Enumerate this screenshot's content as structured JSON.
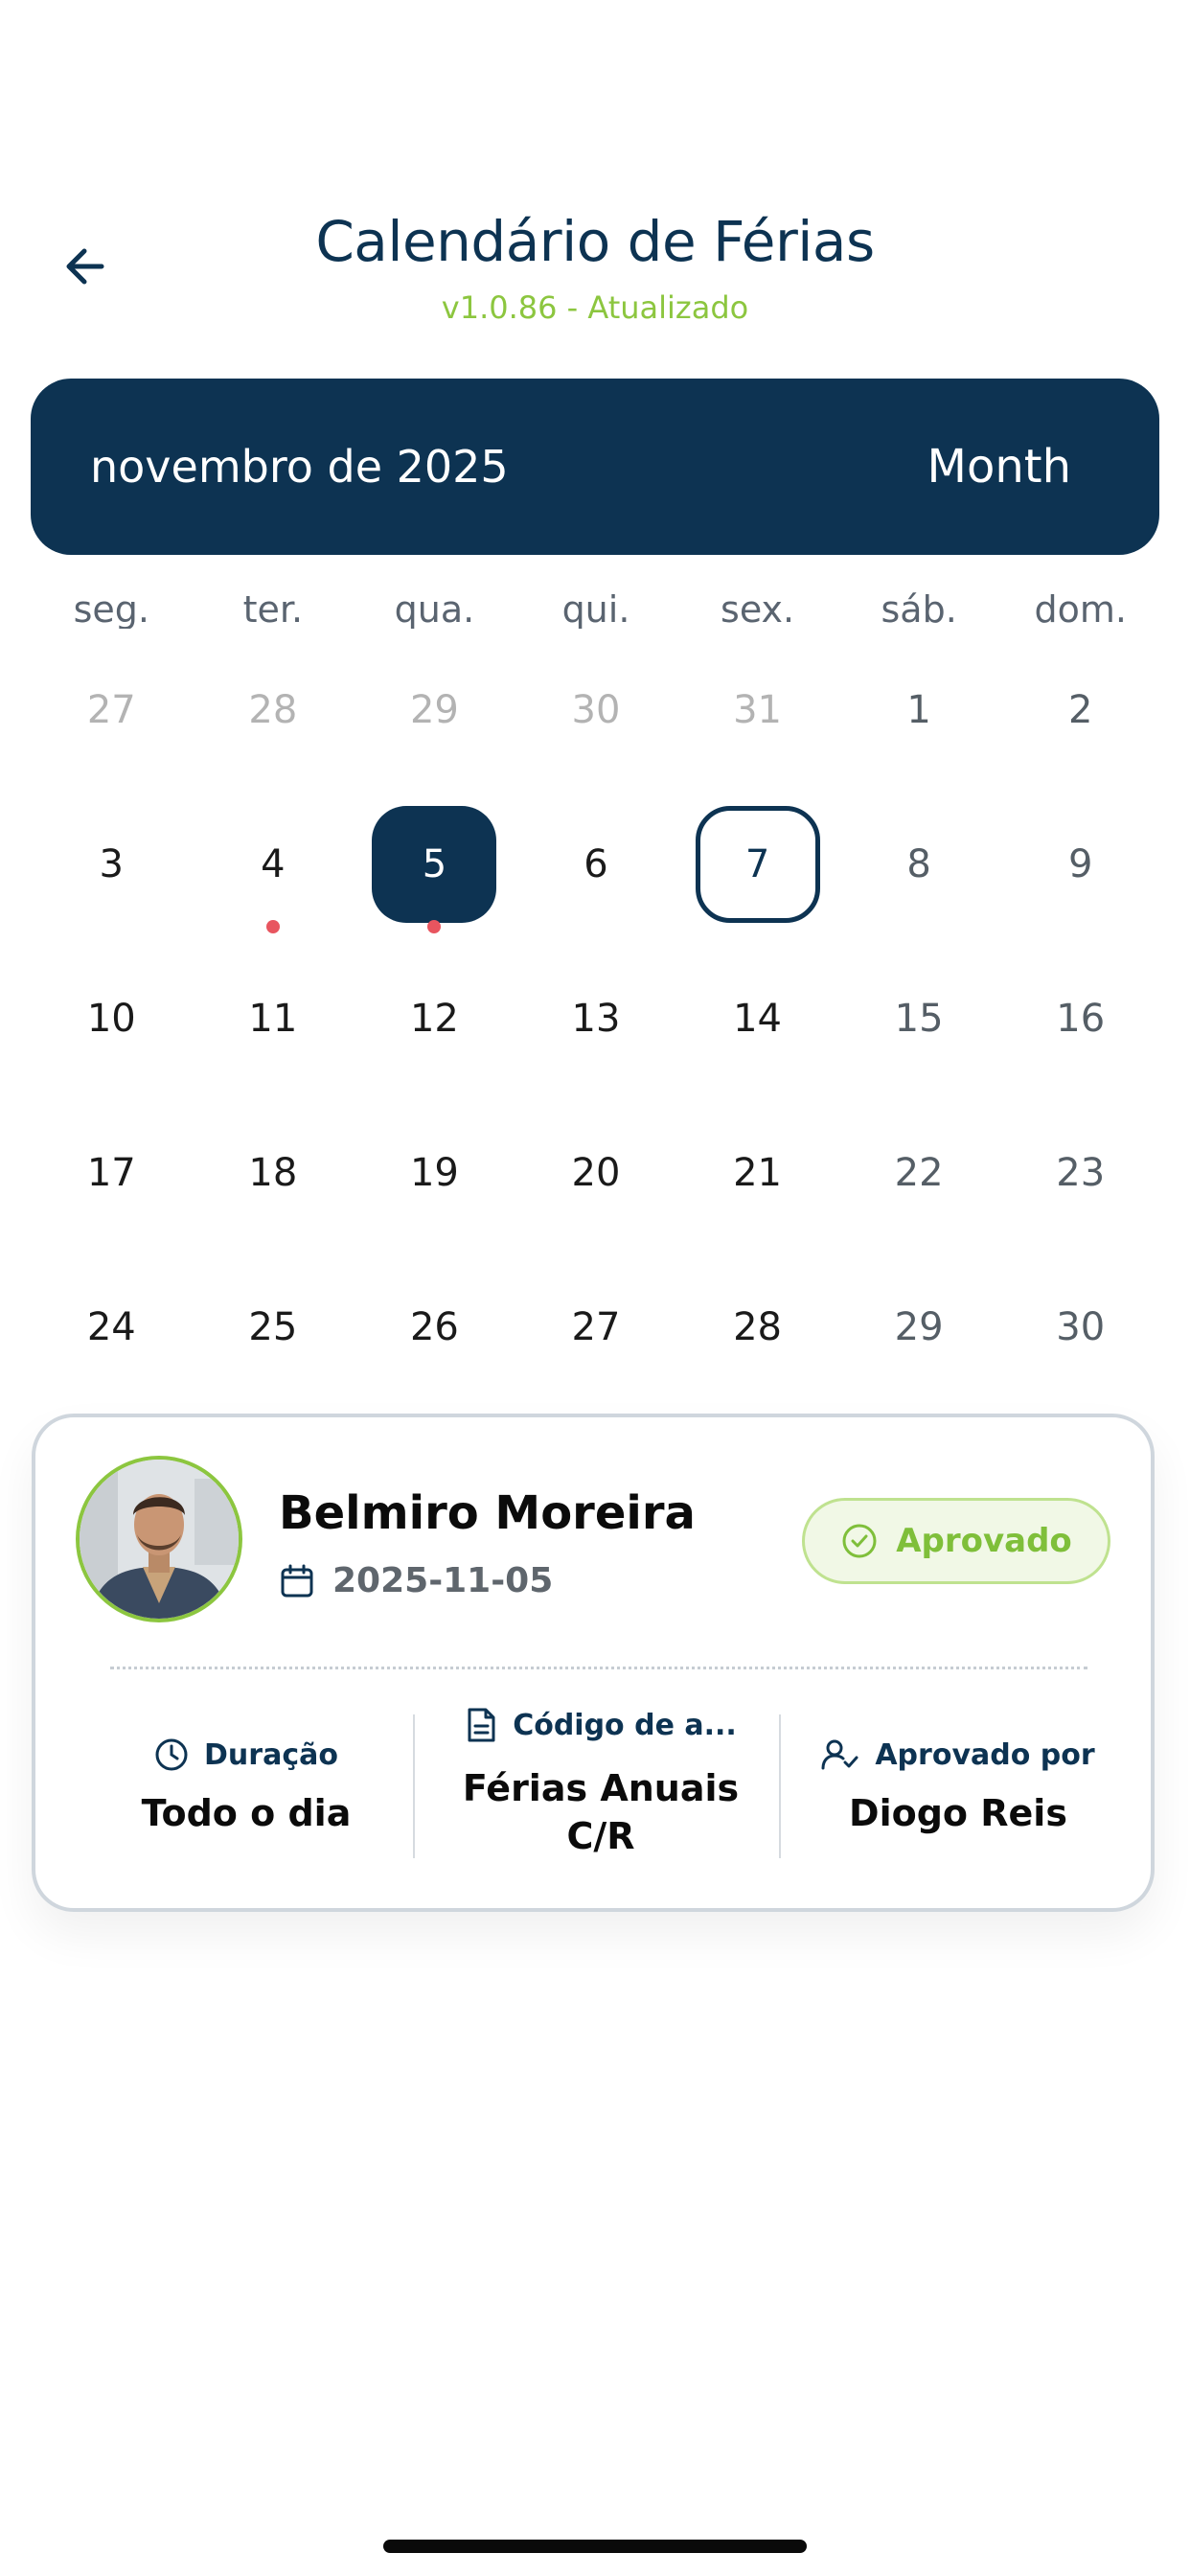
{
  "header": {
    "title": "Calendário de Férias",
    "subtitle": "v1.0.86 - Atualizado",
    "back_icon": "arrow-left-icon"
  },
  "month_bar": {
    "month_label": "novembro de 2025",
    "view_label": "Month"
  },
  "calendar": {
    "weekdays": [
      "seg.",
      "ter.",
      "qua.",
      "qui.",
      "sex.",
      "sáb.",
      "dom."
    ],
    "weeks": [
      [
        {
          "n": "27",
          "muted": true
        },
        {
          "n": "28",
          "muted": true
        },
        {
          "n": "29",
          "muted": true
        },
        {
          "n": "30",
          "muted": true
        },
        {
          "n": "31",
          "muted": true
        },
        {
          "n": "1"
        },
        {
          "n": "2"
        }
      ],
      [
        {
          "n": "3"
        },
        {
          "n": "4",
          "dot": true
        },
        {
          "n": "5",
          "selected": true,
          "dot": true
        },
        {
          "n": "6"
        },
        {
          "n": "7",
          "today": true
        },
        {
          "n": "8"
        },
        {
          "n": "9"
        }
      ],
      [
        {
          "n": "10"
        },
        {
          "n": "11"
        },
        {
          "n": "12"
        },
        {
          "n": "13"
        },
        {
          "n": "14"
        },
        {
          "n": "15"
        },
        {
          "n": "16"
        }
      ],
      [
        {
          "n": "17"
        },
        {
          "n": "18"
        },
        {
          "n": "19"
        },
        {
          "n": "20"
        },
        {
          "n": "21"
        },
        {
          "n": "22"
        },
        {
          "n": "23"
        }
      ],
      [
        {
          "n": "24"
        },
        {
          "n": "25"
        },
        {
          "n": "26"
        },
        {
          "n": "27"
        },
        {
          "n": "28"
        },
        {
          "n": "29"
        },
        {
          "n": "30"
        }
      ]
    ],
    "event_dot_color": "#e8555f",
    "accent_color": "#0d3352"
  },
  "event_card": {
    "name": "Belmiro Moreira",
    "date": "2025-11-05",
    "status": "Aprovado",
    "status_color": "#7fbf3a",
    "duration_label": "Duração",
    "duration_value": "Todo o dia",
    "code_label": "Código de a...",
    "code_value_line1": "Férias Anuais",
    "code_value_line2": "C/R",
    "approved_by_label": "Aprovado por",
    "approved_by_value": "Diogo Reis"
  }
}
